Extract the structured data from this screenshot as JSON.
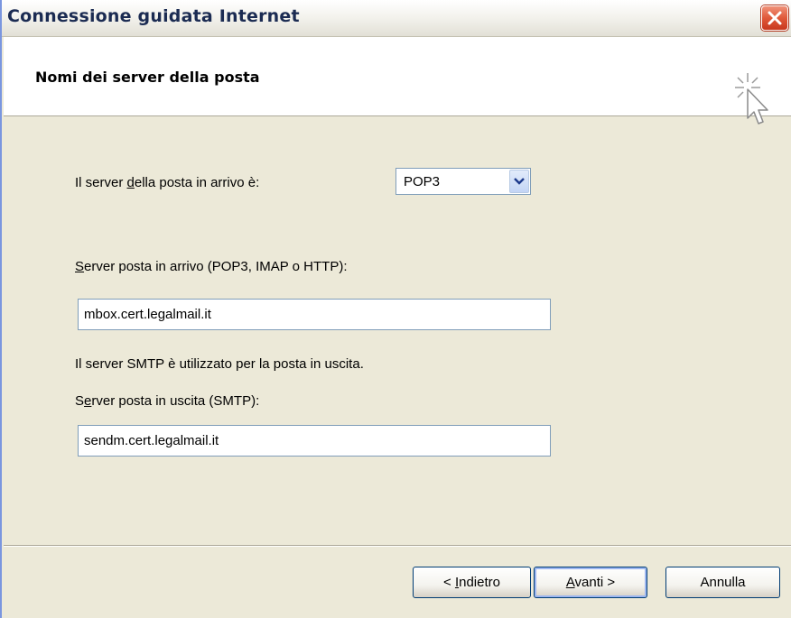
{
  "window": {
    "title": "Connessione guidata Internet"
  },
  "header": {
    "heading": "Nomi dei server della posta"
  },
  "form": {
    "incoming_type_label_pre": "Il server ",
    "incoming_type_label_key": "d",
    "incoming_type_label_post": "ella posta in arrivo è:",
    "incoming_type_value": "POP3",
    "incoming_server_label_key": "S",
    "incoming_server_label_post": "erver posta in arrivo (POP3, IMAP o HTTP):",
    "incoming_server_value": "mbox.cert.legalmail.it",
    "smtp_note": "Il server SMTP è utilizzato per la posta in uscita.",
    "outgoing_server_label_pre": "S",
    "outgoing_server_label_key": "e",
    "outgoing_server_label_post": "rver posta in uscita (SMTP):",
    "outgoing_server_value": "sendm.cert.legalmail.it"
  },
  "buttons": {
    "back_pre": "< ",
    "back_key": "I",
    "back_post": "ndietro",
    "next_key": "A",
    "next_post": "vanti >",
    "cancel": "Annulla"
  },
  "icons": {
    "close": "close-icon",
    "wizard": "cursor-sparkle-icon",
    "dropdown": "chevron-down-icon"
  },
  "colors": {
    "title_text": "#1b2b52",
    "close_button": "#e0593a",
    "window_bg": "#ece9d8",
    "field_border": "#7f9db9"
  }
}
